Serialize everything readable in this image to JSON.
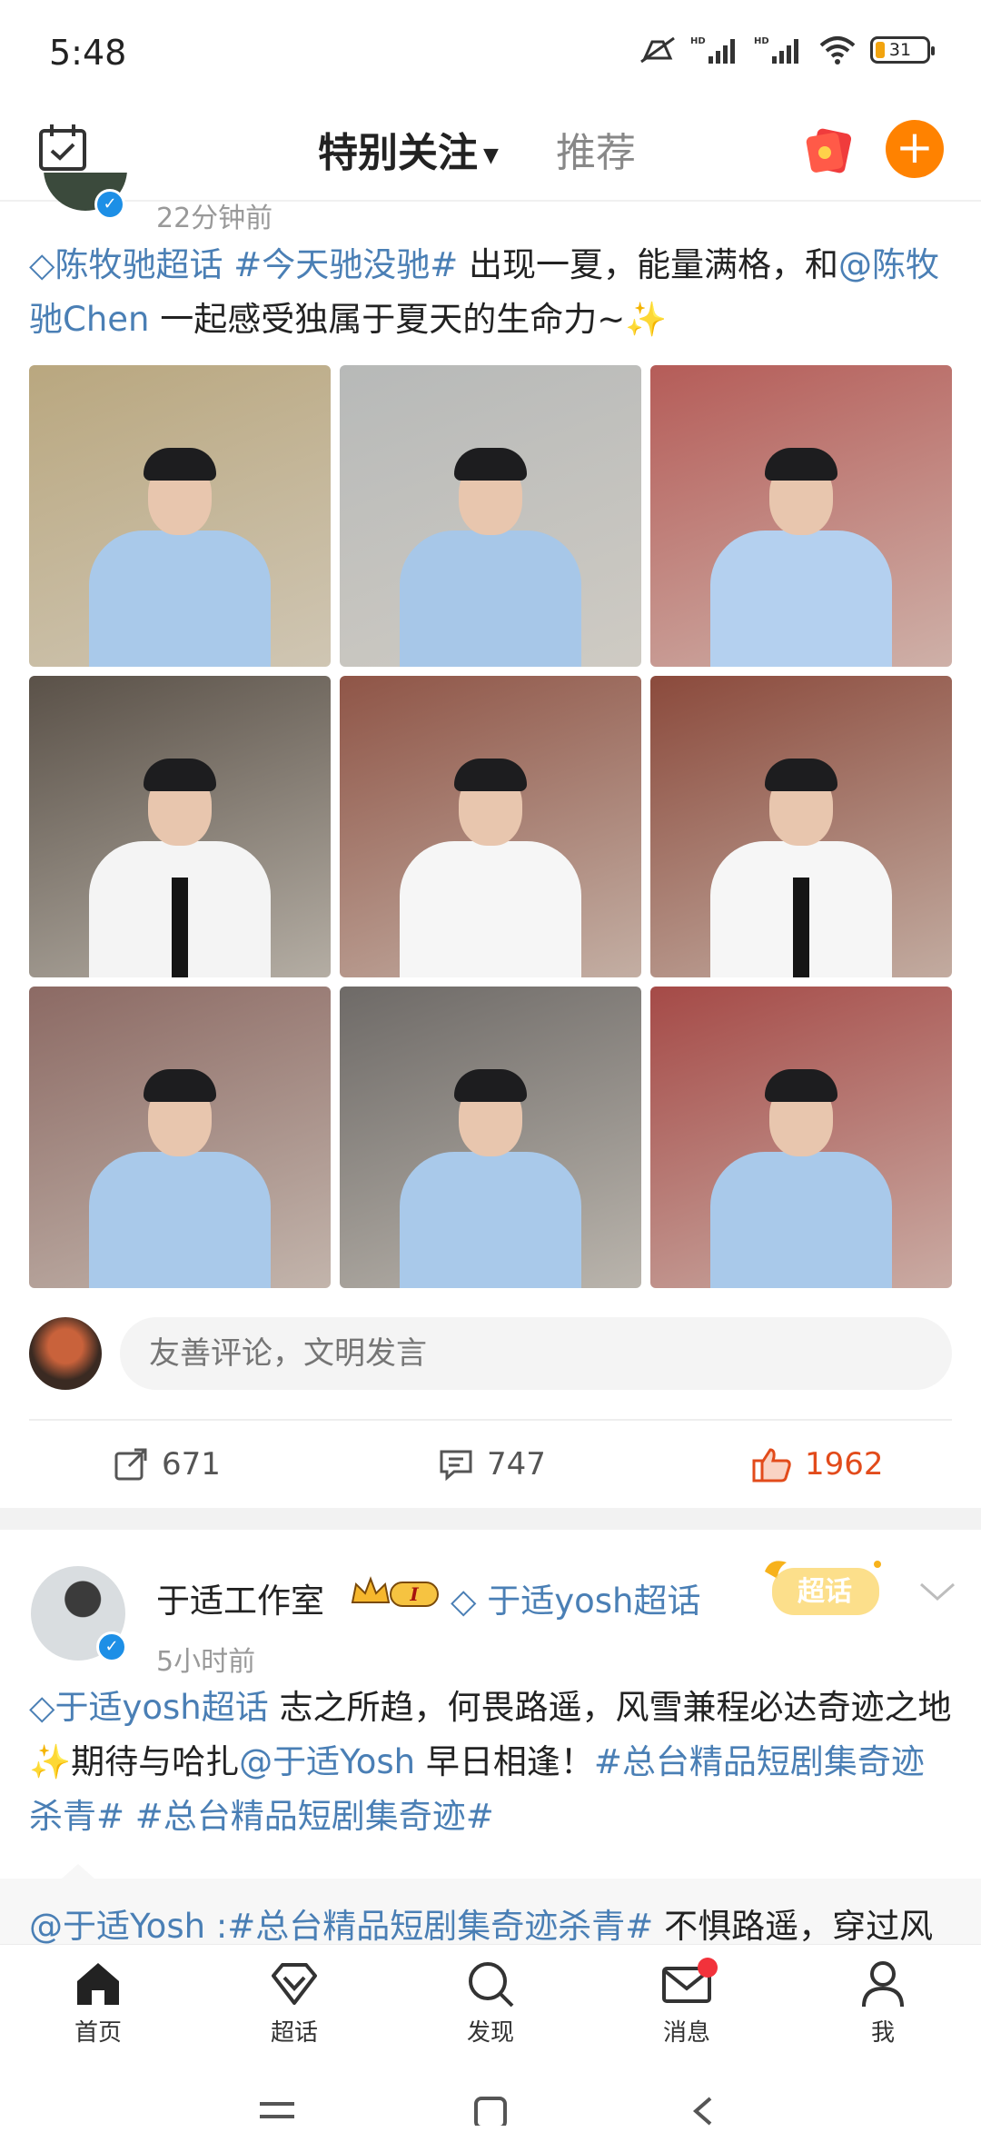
{
  "status_bar": {
    "time": "5:48",
    "battery": "31"
  },
  "top_nav": {
    "active_tab": "特别关注",
    "tab_recommend": "推荐"
  },
  "post1": {
    "time": "22分钟前",
    "text": {
      "topic1": "陈牧驰超话",
      "topic2": "#今天驰没驰#",
      "plain1": " 出现一夏，能量满格，和",
      "mention_at": "@",
      "mention_name": "陈牧驰Chen",
      "plain2": " 一起感受独属于夏天的生命力~✨"
    },
    "photos": [
      {
        "bg": "#b9a77f",
        "shirt": "#a9c9ea",
        "tie": false
      },
      {
        "bg": "#b7b9b8",
        "shirt": "#a7c7e8",
        "tie": false
      },
      {
        "bg": "#b55c58",
        "shirt": "#b4d0ef",
        "tie": false
      },
      {
        "bg": "#5a5148",
        "shirt": "#f4f4f4",
        "tie": true
      },
      {
        "bg": "#8f5547",
        "shirt": "#f6f6f6",
        "tie": false
      },
      {
        "bg": "#8b4a3c",
        "shirt": "#f6f6f6",
        "tie": true
      },
      {
        "bg": "#8c6a64",
        "shirt": "#a9c9ea",
        "tie": false
      },
      {
        "bg": "#6e6a67",
        "shirt": "#a9c9ea",
        "tie": false
      },
      {
        "bg": "#a54a47",
        "shirt": "#a9c9ea",
        "tie": false
      }
    ],
    "comment_placeholder": "友善评论，文明发言",
    "actions": {
      "repost": "671",
      "comment": "747",
      "like": "1962"
    }
  },
  "post2": {
    "author": "于适工作室",
    "badge_level": "I",
    "topic_tag": "于适yosh超话",
    "chaohua_label": "超话",
    "time": "5小时前",
    "text": {
      "topic": "于适yosh超话",
      "plain1": "  志之所趋，何畏路遥，风雪兼程必达奇迹之地✨期待与哈扎",
      "mention": "@于适Yosh",
      "plain2": " 早日相逢！",
      "tag1": "#总台精品短剧集奇迹杀青#",
      "tag2": "#总台精品短剧集奇迹#"
    },
    "repost": {
      "mention": "@于适Yosh",
      "sep": " :",
      "tag": "#总台精品短剧集奇迹杀青#",
      "plain": " 不惧路遥，穿过风"
    }
  },
  "bottom_nav": [
    {
      "label": "首页",
      "icon": "home-icon"
    },
    {
      "label": "超话",
      "icon": "diamond-icon"
    },
    {
      "label": "发现",
      "icon": "search-icon"
    },
    {
      "label": "消息",
      "icon": "mail-icon"
    },
    {
      "label": "我",
      "icon": "profile-icon"
    }
  ],
  "colors": {
    "accent": "#ff8200",
    "link": "#4a7fb5",
    "like": "#e24b1b",
    "tab_underline": "#f7b21b"
  }
}
